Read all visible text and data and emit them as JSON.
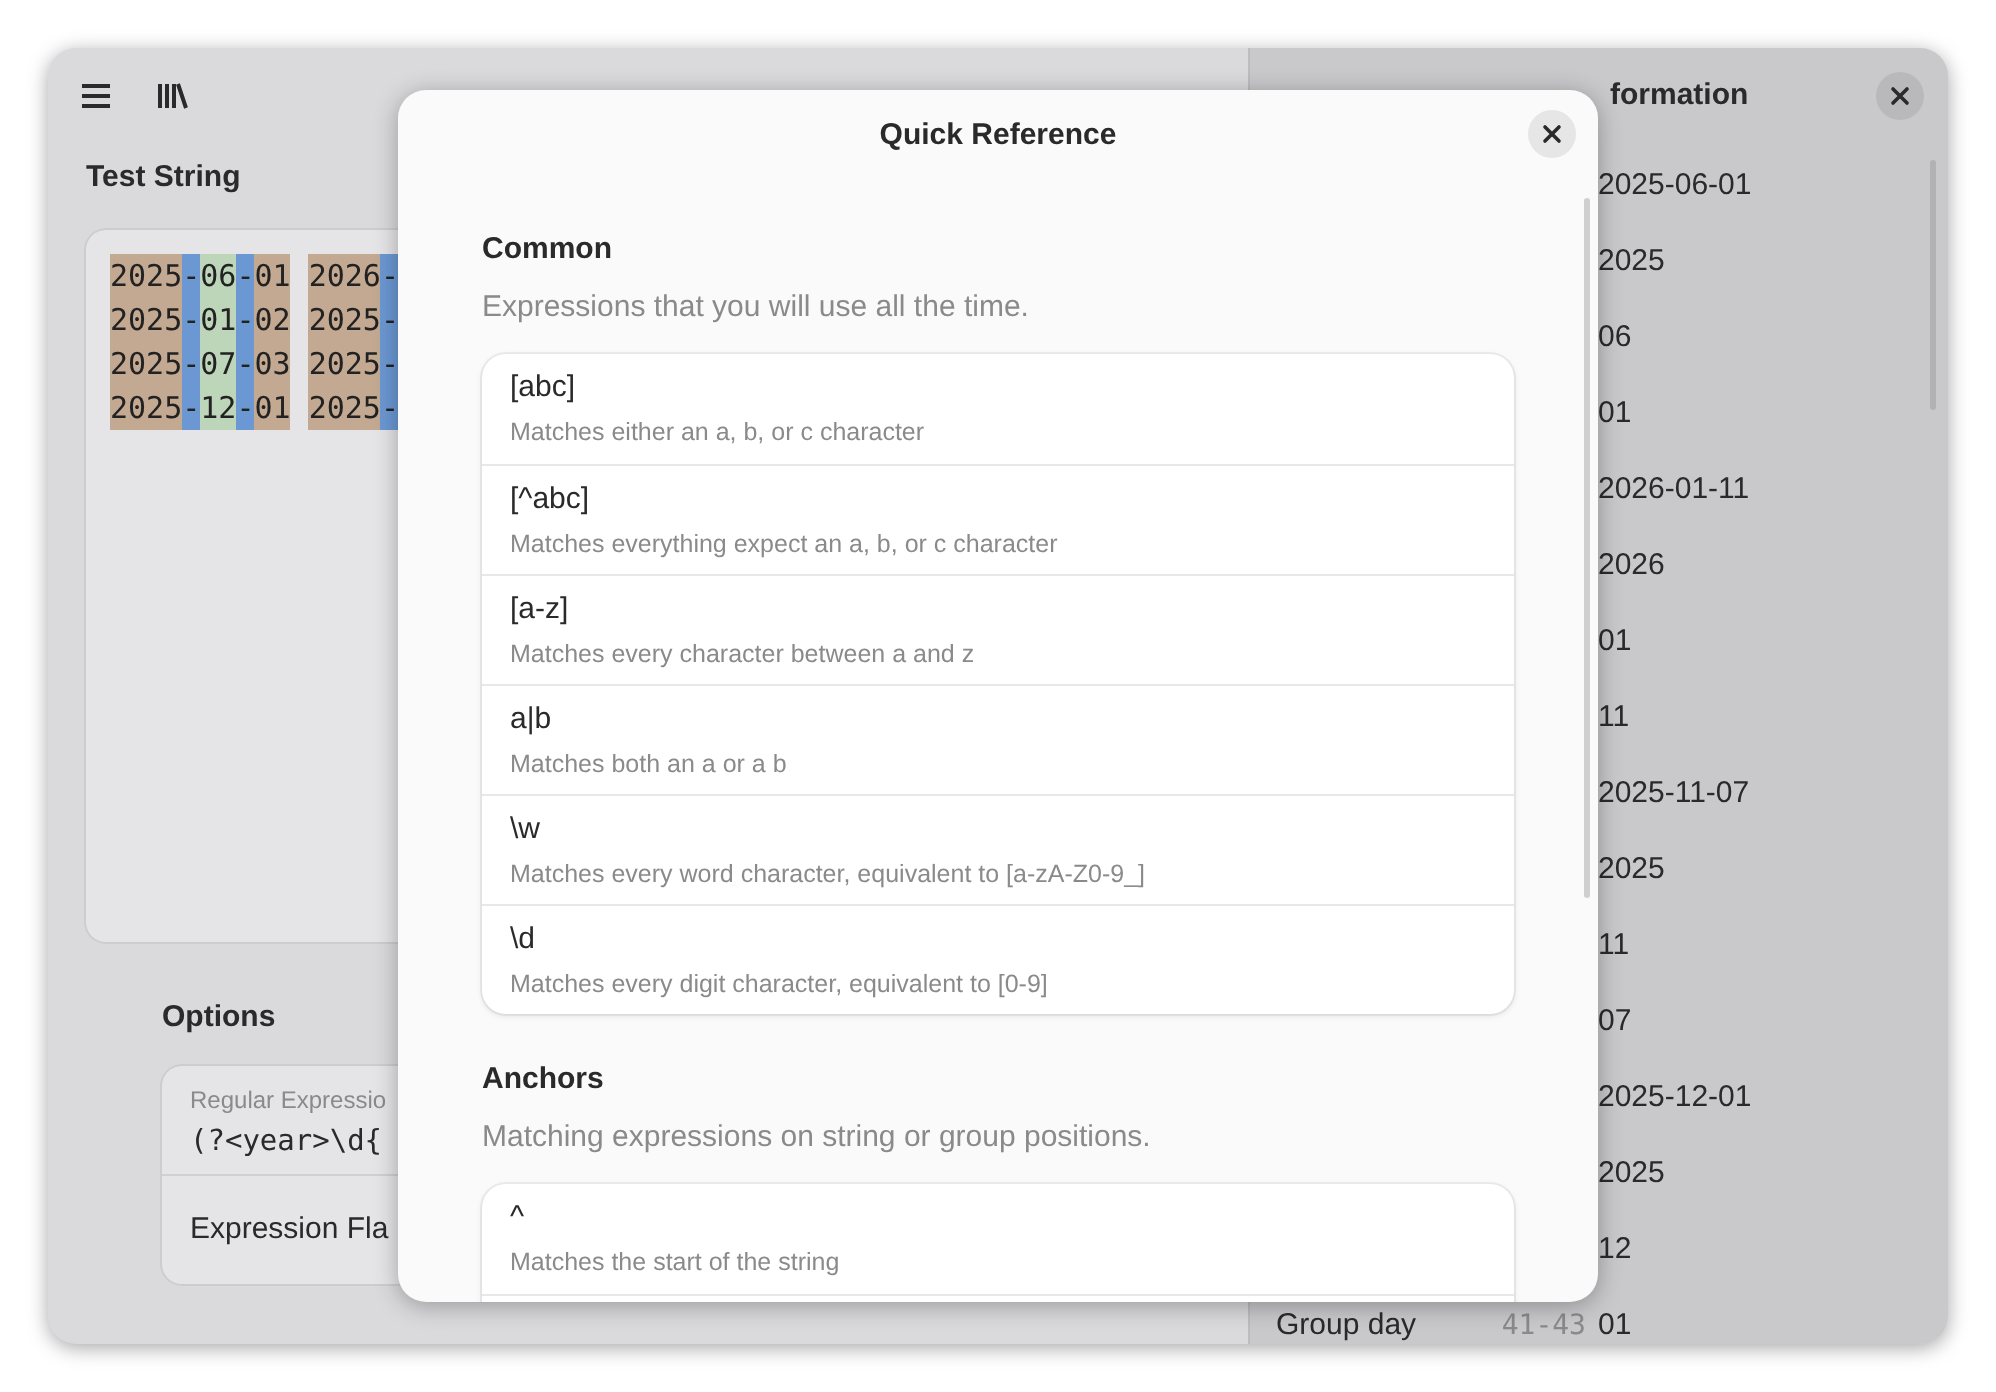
{
  "test_string": {
    "title": "Test String",
    "lines": [
      [
        [
          {
            "text": "2025",
            "kind": "year"
          },
          {
            "text": "-",
            "kind": "sep"
          },
          {
            "text": "06",
            "kind": "month"
          },
          {
            "text": "-",
            "kind": "sep"
          },
          {
            "text": "01",
            "kind": "day"
          }
        ],
        [
          {
            "text": "2026",
            "kind": "year"
          },
          {
            "text": "-",
            "kind": "sep"
          }
        ]
      ],
      [
        [
          {
            "text": "2025",
            "kind": "year"
          },
          {
            "text": "-",
            "kind": "sep"
          },
          {
            "text": "01",
            "kind": "month"
          },
          {
            "text": "-",
            "kind": "sep"
          },
          {
            "text": "02",
            "kind": "day"
          }
        ],
        [
          {
            "text": "2025",
            "kind": "year"
          },
          {
            "text": "-",
            "kind": "sep"
          }
        ]
      ],
      [
        [
          {
            "text": "2025",
            "kind": "year"
          },
          {
            "text": "-",
            "kind": "sep"
          },
          {
            "text": "07",
            "kind": "month"
          },
          {
            "text": "-",
            "kind": "sep"
          },
          {
            "text": "03",
            "kind": "day"
          }
        ],
        [
          {
            "text": "2025",
            "kind": "year"
          },
          {
            "text": "-",
            "kind": "sep"
          }
        ]
      ],
      [
        [
          {
            "text": "2025",
            "kind": "year"
          },
          {
            "text": "-",
            "kind": "sep"
          },
          {
            "text": "12",
            "kind": "month"
          },
          {
            "text": "-",
            "kind": "sep"
          },
          {
            "text": "01",
            "kind": "day"
          }
        ],
        [
          {
            "text": "2025",
            "kind": "year"
          },
          {
            "text": "-",
            "kind": "sep"
          }
        ]
      ]
    ]
  },
  "options": {
    "title": "Options",
    "regex_label": "Regular Expressio",
    "regex_value": "(?<year>\\d{",
    "flags_label": "Expression Fla"
  },
  "match_panel": {
    "title": "formation",
    "rows": [
      {
        "value": "2025-06-01"
      },
      {
        "value": "2025"
      },
      {
        "value": "06"
      },
      {
        "value": "01"
      },
      {
        "value": "2026-01-11"
      },
      {
        "value": "2026"
      },
      {
        "value": "01"
      },
      {
        "value": "11"
      },
      {
        "value": "2025-11-07"
      },
      {
        "value": "2025"
      },
      {
        "value": "11"
      },
      {
        "value": "07"
      },
      {
        "value": "2025-12-01"
      },
      {
        "value": "2025"
      },
      {
        "value": "12"
      },
      {
        "label": "Group day",
        "range": "41-43",
        "value": "01"
      }
    ]
  },
  "dialog": {
    "title": "Quick Reference",
    "sections": [
      {
        "title": "Common",
        "subtitle": "Expressions that you will use all the time.",
        "items": [
          {
            "code": "[abc]",
            "description": "Matches either an a, b, or c character"
          },
          {
            "code": "[^abc]",
            "description": "Matches everything expect an a, b, or c character"
          },
          {
            "code": "[a-z]",
            "description": "Matches every character between a and z"
          },
          {
            "code": "a|b",
            "description": "Matches both an a or a b"
          },
          {
            "code": "\\w",
            "description": "Matches every word character, equivalent to [a-zA-Z0-9_]"
          },
          {
            "code": "\\d",
            "description": "Matches every digit character, equivalent to [0-9]"
          }
        ]
      },
      {
        "title": "Anchors",
        "subtitle": "Matching expressions on string or group positions.",
        "items": [
          {
            "code": "^",
            "description": "Matches the start of the string"
          }
        ]
      }
    ]
  }
}
